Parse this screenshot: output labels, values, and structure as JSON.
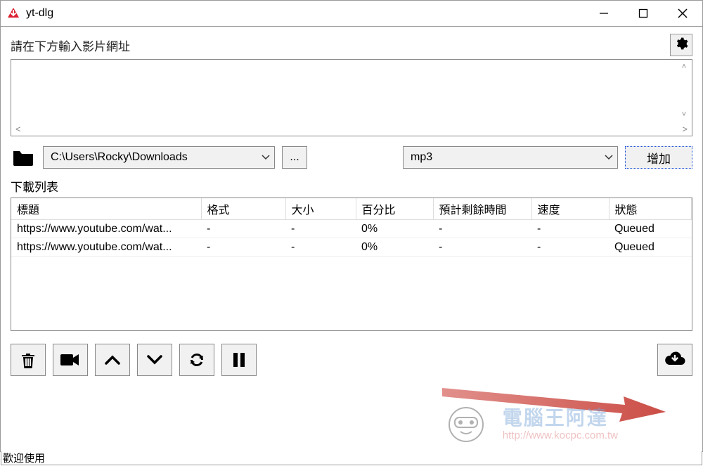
{
  "window": {
    "title": "yt-dlg"
  },
  "labels": {
    "url_prompt": "請在下方輸入影片網址",
    "download_list": "下載列表"
  },
  "path": {
    "value": "C:\\Users\\Rocky\\Downloads",
    "browse_label": "..."
  },
  "format": {
    "value": "mp3"
  },
  "buttons": {
    "add": "增加"
  },
  "table": {
    "headers": {
      "title": "標題",
      "ext": "格式",
      "size": "大小",
      "percent": "百分比",
      "eta": "預計剩餘時間",
      "speed": "速度",
      "status": "狀態"
    },
    "rows": [
      {
        "title": "https://www.youtube.com/wat...",
        "ext": "-",
        "size": "-",
        "percent": "0%",
        "eta": "-",
        "speed": "-",
        "status": "Queued"
      },
      {
        "title": "https://www.youtube.com/wat...",
        "ext": "-",
        "size": "-",
        "percent": "0%",
        "eta": "-",
        "speed": "-",
        "status": "Queued"
      }
    ]
  },
  "statusbar": {
    "text": "歡迎使用"
  },
  "watermark": {
    "text": "電腦王阿達",
    "url": "http://www.kocpc.com.tw"
  }
}
